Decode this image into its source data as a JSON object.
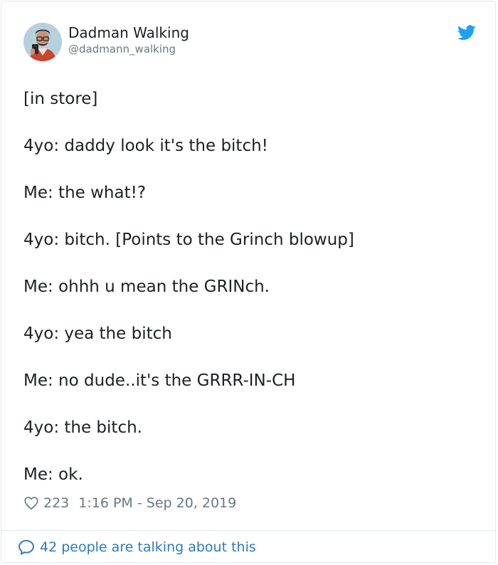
{
  "colors": {
    "text": "#1c2022",
    "secondary": "#697882",
    "accent": "#2b7bb9",
    "twitter_blue": "#1da1f2",
    "border": "#e1e8ed"
  },
  "author": {
    "name": "Dadman Walking",
    "handle": "@dadmann_walking",
    "avatar_icon": "profile-photo"
  },
  "header": {
    "logo_icon": "twitter-bird-icon"
  },
  "tweet": {
    "lines": [
      "[in store]",
      "4yo: daddy look it's the bitch!",
      "Me: the what!?",
      "4yo: bitch. [Points to the Grinch blowup]",
      "Me: ohhh u mean the GRINch.",
      "4yo: yea the bitch",
      "Me: no dude..it's the GRRR-IN-CH",
      "4yo: the bitch.",
      "Me: ok."
    ]
  },
  "meta": {
    "heart_icon": "heart-icon",
    "likes": "223",
    "timestamp": "1:16 PM - Sep 20, 2019"
  },
  "footer": {
    "bubble_icon": "speech-bubble-icon",
    "label": "42 people are talking about this"
  }
}
